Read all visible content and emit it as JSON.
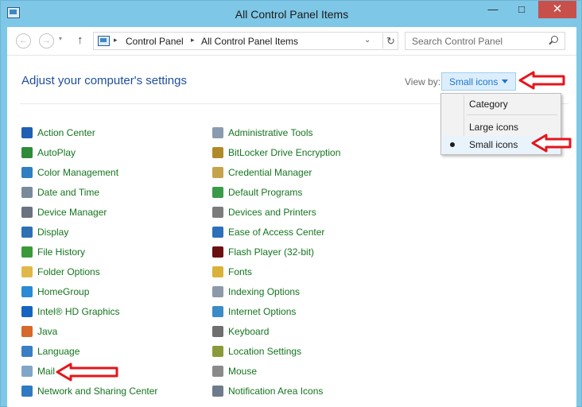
{
  "window": {
    "title": "All Control Panel Items",
    "minimize": "—",
    "maximize": "□",
    "close": "✕"
  },
  "address": {
    "back": "←",
    "forward": "→",
    "recent": "▾",
    "up": "↑",
    "crumbs": [
      "Control Panel",
      "All Control Panel Items"
    ],
    "separator": "▸",
    "dropdown": "⌄",
    "refresh": "↻",
    "search_placeholder": "Search Control Panel"
  },
  "header": {
    "title": "Adjust your computer's settings",
    "view_by_label": "View by:",
    "view_by_value": "Small icons"
  },
  "view_menu": {
    "options": [
      "Category",
      "Large icons",
      "Small icons"
    ],
    "selected": "Small icons"
  },
  "items_left": [
    {
      "label": "Action Center",
      "icon": "flag-icon",
      "color": "#1f5fb4"
    },
    {
      "label": "AutoPlay",
      "icon": "autoplay-icon",
      "color": "#2e8b3a"
    },
    {
      "label": "Color Management",
      "icon": "color-management-icon",
      "color": "#2f7fc1"
    },
    {
      "label": "Date and Time",
      "icon": "clock-icon",
      "color": "#7a8a9c"
    },
    {
      "label": "Device Manager",
      "icon": "device-manager-icon",
      "color": "#6b7280"
    },
    {
      "label": "Display",
      "icon": "monitor-icon",
      "color": "#2f6fb4"
    },
    {
      "label": "File History",
      "icon": "file-history-icon",
      "color": "#3a9a3a"
    },
    {
      "label": "Folder Options",
      "icon": "folder-icon",
      "color": "#e0b84a"
    },
    {
      "label": "HomeGroup",
      "icon": "homegroup-icon",
      "color": "#2b8ad6"
    },
    {
      "label": "Intel® HD Graphics",
      "icon": "intel-graphics-icon",
      "color": "#1565c0"
    },
    {
      "label": "Java",
      "icon": "java-icon",
      "color": "#d7692a"
    },
    {
      "label": "Language",
      "icon": "language-icon",
      "color": "#3a7ec4"
    },
    {
      "label": "Mail",
      "icon": "mail-icon",
      "color": "#7fa6c9"
    },
    {
      "label": "Network and Sharing Center",
      "icon": "network-icon",
      "color": "#2f7ac0"
    }
  ],
  "items_right": [
    {
      "label": "Administrative Tools",
      "icon": "admin-tools-icon",
      "color": "#8a9bb0"
    },
    {
      "label": "BitLocker Drive Encryption",
      "icon": "bitlocker-icon",
      "color": "#b08a2a"
    },
    {
      "label": "Credential Manager",
      "icon": "credential-icon",
      "color": "#c5a34a"
    },
    {
      "label": "Default Programs",
      "icon": "default-programs-icon",
      "color": "#3a9a4a"
    },
    {
      "label": "Devices and Printers",
      "icon": "printer-icon",
      "color": "#7b7b7b"
    },
    {
      "label": "Ease of Access Center",
      "icon": "ease-of-access-icon",
      "color": "#2d6fb8"
    },
    {
      "label": "Flash Player (32-bit)",
      "icon": "flash-icon",
      "color": "#6b1010"
    },
    {
      "label": "Fonts",
      "icon": "fonts-icon",
      "color": "#d9b23a"
    },
    {
      "label": "Indexing Options",
      "icon": "indexing-icon",
      "color": "#8c99a8"
    },
    {
      "label": "Internet Options",
      "icon": "internet-options-icon",
      "color": "#3b8bc7"
    },
    {
      "label": "Keyboard",
      "icon": "keyboard-icon",
      "color": "#6f6f6f"
    },
    {
      "label": "Location Settings",
      "icon": "location-icon",
      "color": "#8a9a3a"
    },
    {
      "label": "Mouse",
      "icon": "mouse-icon",
      "color": "#8a8a8a"
    },
    {
      "label": "Notification Area Icons",
      "icon": "notification-icon",
      "color": "#6d7c8c"
    }
  ],
  "colors": {
    "item_text": "#14741e",
    "heading": "#1e4e9c",
    "annotation_arrow": "#e4161b"
  }
}
